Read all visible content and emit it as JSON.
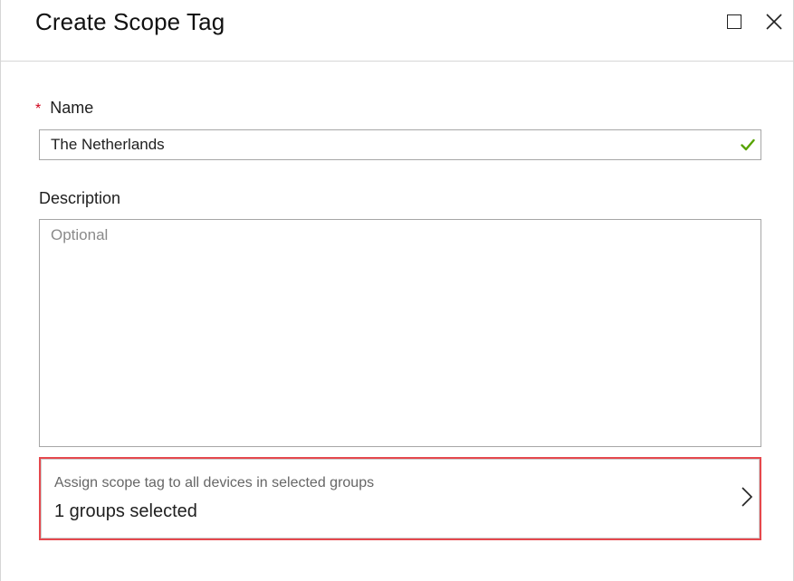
{
  "blade": {
    "title": "Create Scope Tag",
    "controls": {
      "maximize_icon": "maximize-icon",
      "close_icon": "close-icon"
    }
  },
  "form": {
    "name": {
      "required_marker": "*",
      "label": "Name",
      "value": "The Netherlands",
      "valid_icon": "checkmark-icon",
      "valid_color": "#57a300"
    },
    "description": {
      "label": "Description",
      "placeholder": "Optional",
      "value": ""
    },
    "assign_groups": {
      "subtitle": "Assign scope tag to all devices in selected groups",
      "value": "1 groups selected",
      "chevron_icon": "chevron-right-icon",
      "highlight_color": "#e5484d"
    }
  }
}
